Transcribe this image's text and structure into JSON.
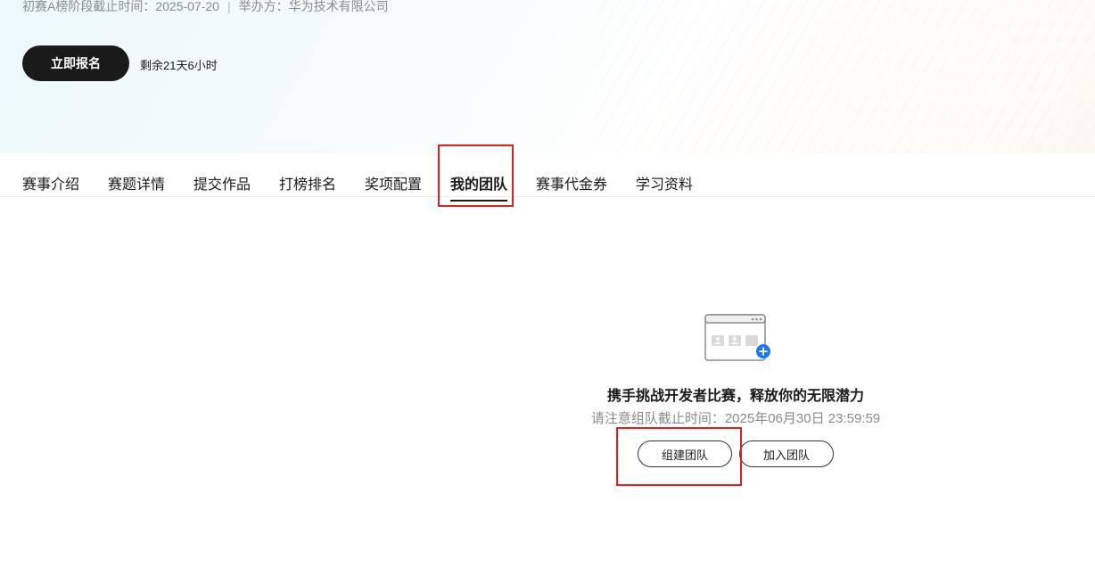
{
  "banner": {
    "stage_deadline": "初赛A榜阶段截止时间：2025-07-20",
    "separator": "|",
    "organizer": "举办方：华为技术有限公司",
    "register_label": "立即报名",
    "remaining_time": "剩余21天6小时"
  },
  "tabs": [
    {
      "label": "赛事介绍",
      "active": false
    },
    {
      "label": "赛题详情",
      "active": false
    },
    {
      "label": "提交作品",
      "active": false
    },
    {
      "label": "打榜排名",
      "active": false
    },
    {
      "label": "奖项配置",
      "active": false
    },
    {
      "label": "我的团队",
      "active": true
    },
    {
      "label": "赛事代金券",
      "active": false
    },
    {
      "label": "学习资料",
      "active": false
    }
  ],
  "team": {
    "icon": "team-board-add-icon",
    "title": "携手挑战开发者比赛，释放你的无限潜力",
    "deadline_note": "请注意组队截止时间：2025年06月30日 23:59:59",
    "create_label": "组建团队",
    "join_label": "加入团队"
  },
  "colors": {
    "primary_dark": "#1a1a1a",
    "highlight": "#e02020",
    "accent_blue": "#1677ff",
    "muted_text": "#8a8a8a"
  }
}
